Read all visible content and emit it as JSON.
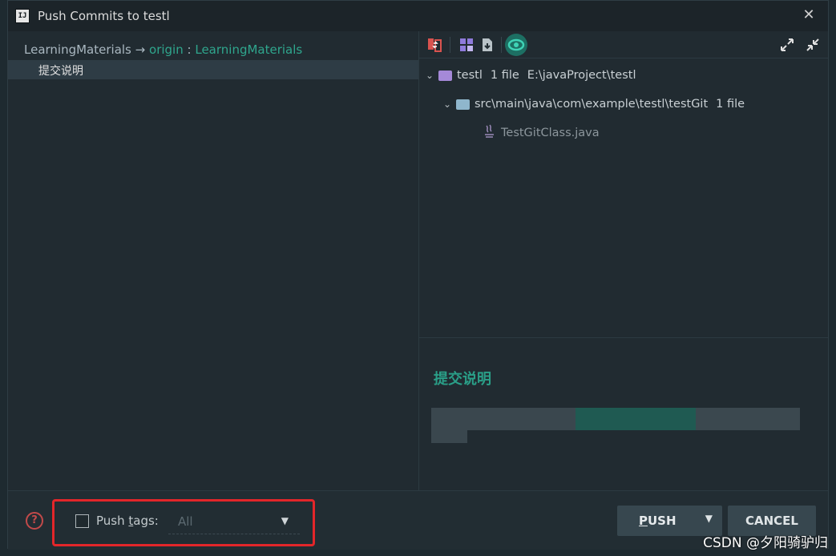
{
  "window": {
    "app_icon_label": "IJ",
    "title": "Push Commits to testl",
    "close_glyph": "✕"
  },
  "push_target": {
    "local_branch": "LearningMaterials",
    "arrow": "→",
    "remote": "origin",
    "separator": ":",
    "remote_branch": "LearningMaterials"
  },
  "commits": [
    {
      "message": "提交说明"
    }
  ],
  "toolbar": {
    "icons": [
      "diff-icon",
      "group-by-icon",
      "export-icon",
      "eye-icon",
      "expand-all-icon",
      "collapse-all-icon"
    ]
  },
  "tree": {
    "root": {
      "name": "testl",
      "count": "1 file",
      "path": "E:\\javaProject\\testl"
    },
    "folder": {
      "name": "src\\main\\java\\com\\example\\testl\\testGit",
      "count": "1 file"
    },
    "file": {
      "name": "TestGitClass.java"
    }
  },
  "details": {
    "title": "提交说明"
  },
  "bottom": {
    "push_tags_label_pre": "Push ",
    "push_tags_label_mnemonic": "t",
    "push_tags_label_post": "ags:",
    "push_tags_checked": false,
    "tags_select_value": "All",
    "push_button_mnemonic": "P",
    "push_button_rest": "USH",
    "cancel_label": "CANCEL"
  },
  "watermark": "CSDN @夕阳骑驴归",
  "colors": {
    "accent_teal": "#2fa68d",
    "highlight_red": "#e3262a",
    "background": "#222d33"
  }
}
